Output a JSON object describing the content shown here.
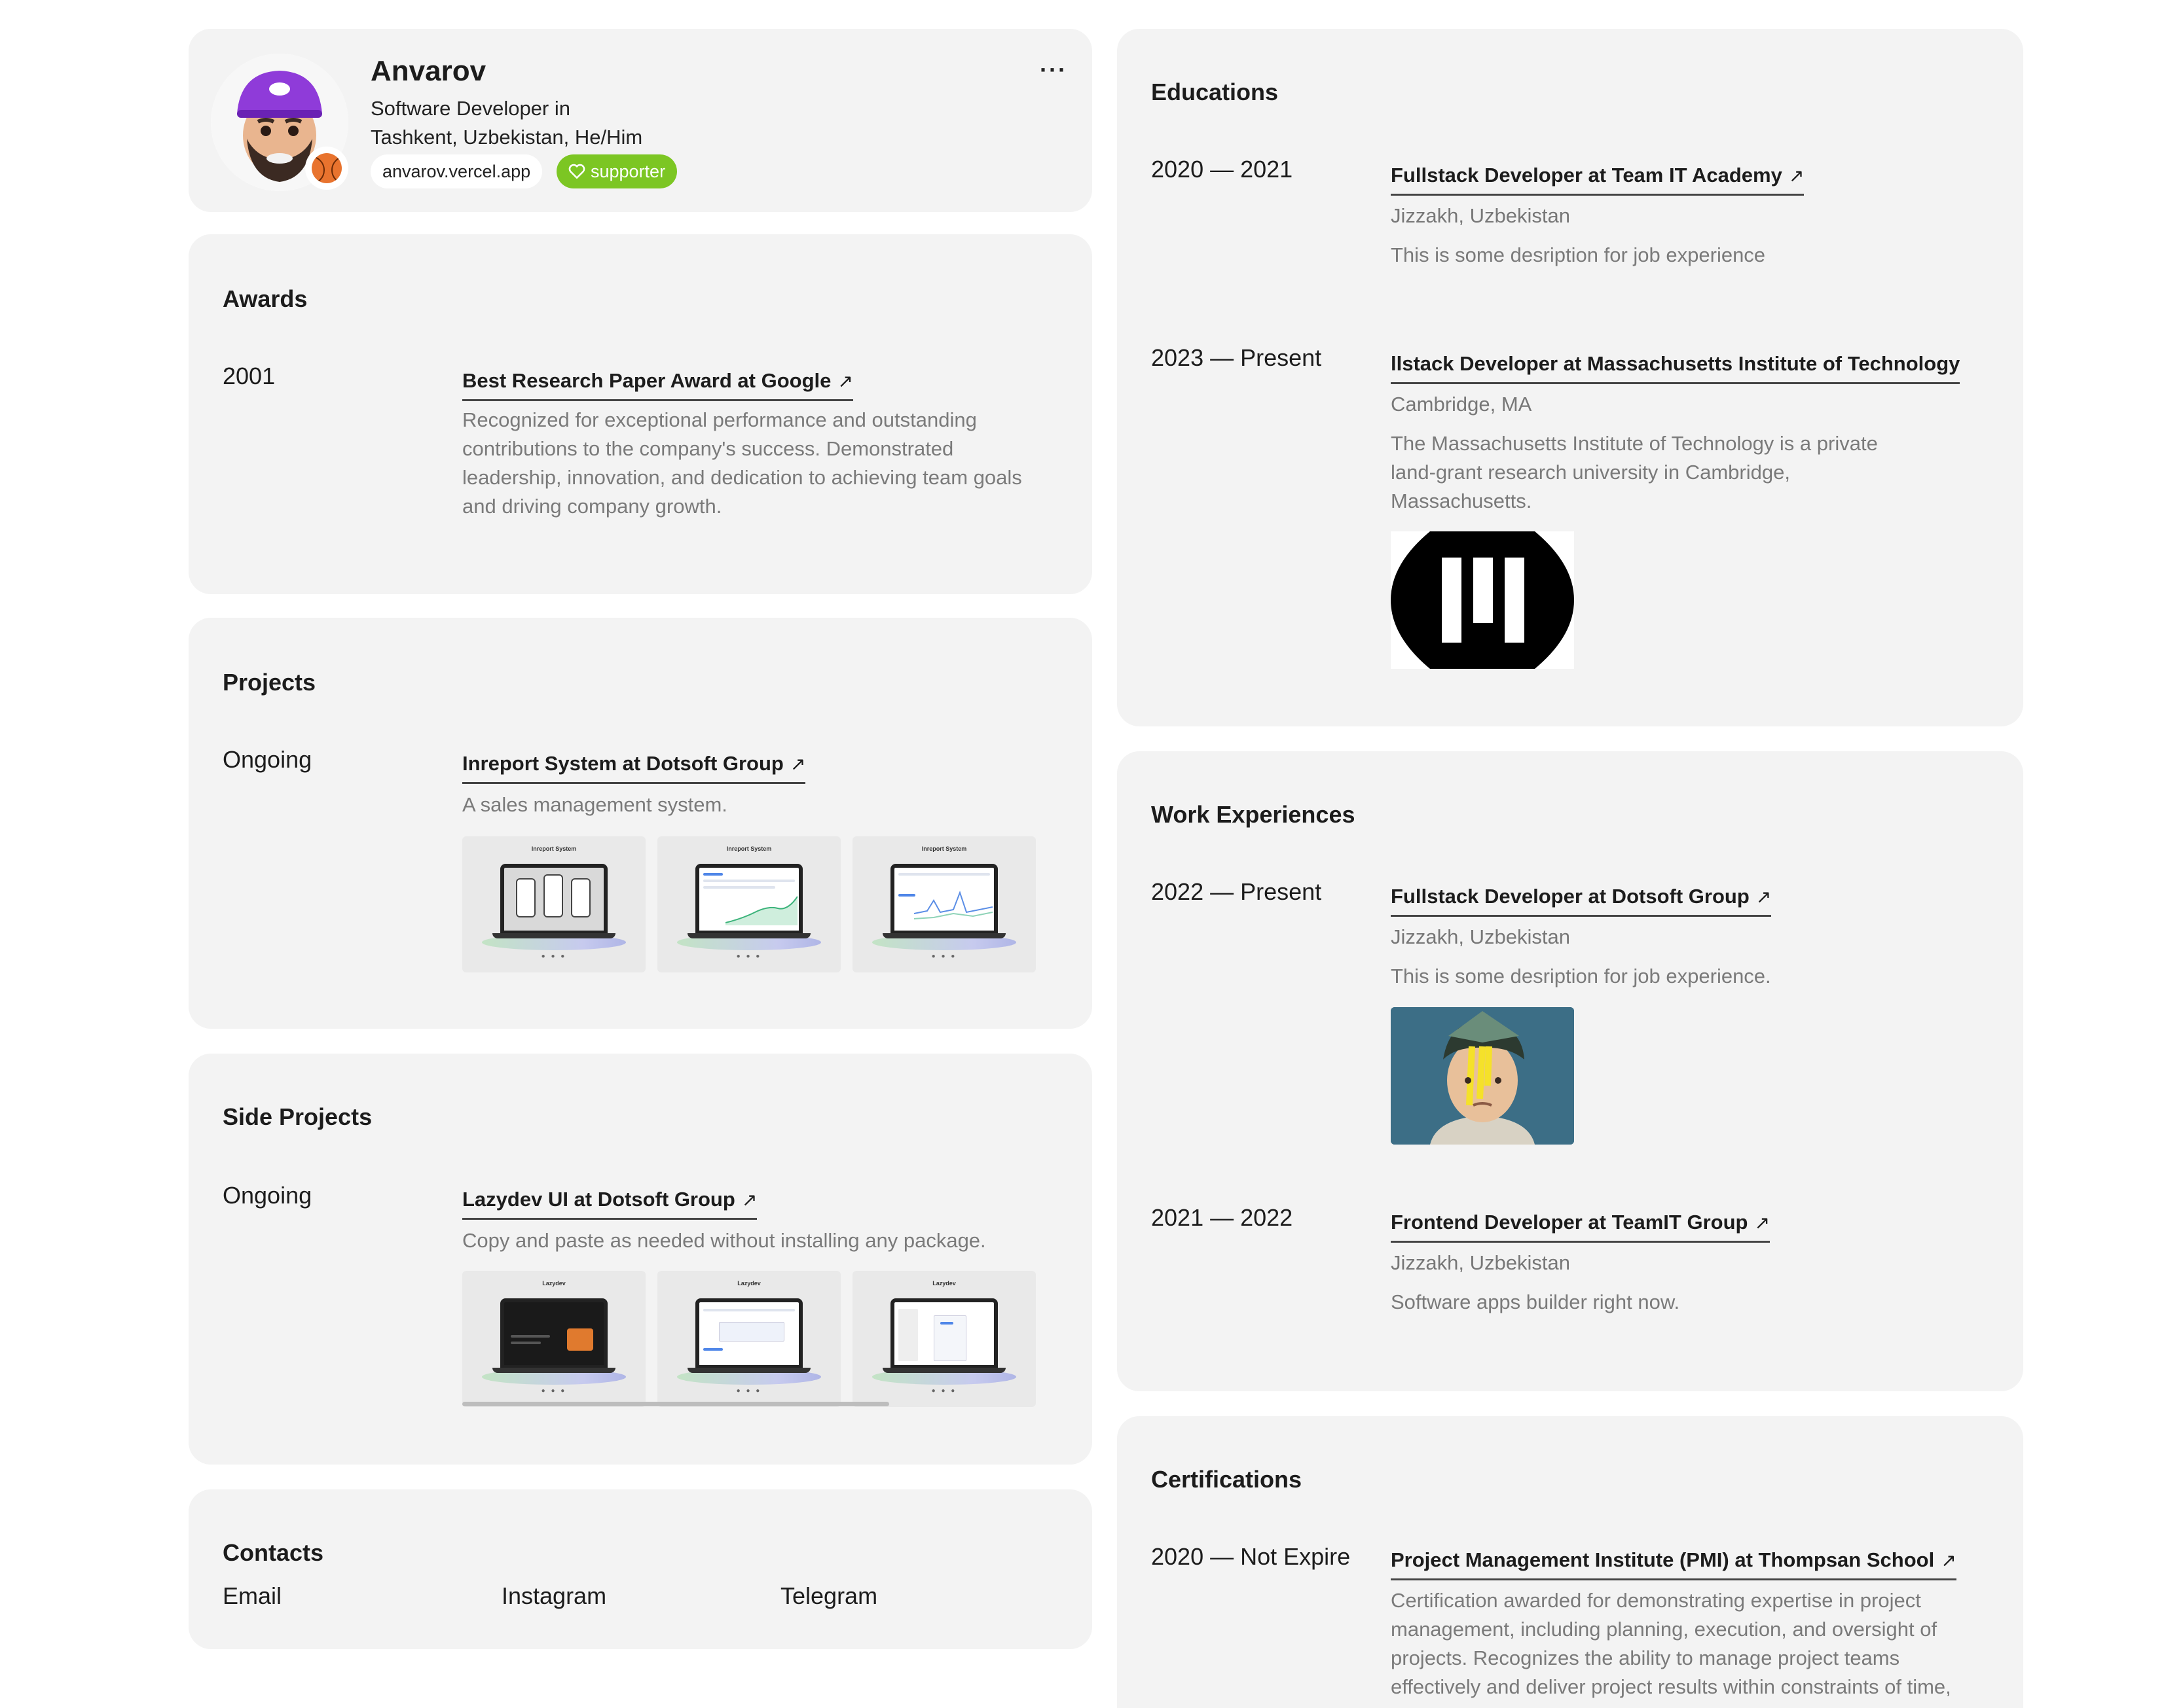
{
  "profile": {
    "name": "Anvarov",
    "subtitle_line1": "Software Developer in",
    "subtitle_line2": "Tashkent, Uzbekistan, He/Him",
    "site_pill": "anvarov.vercel.app",
    "supporter_pill": "supporter",
    "more_icon": "more-horizontal-icon",
    "more_label": "···"
  },
  "awards": {
    "title": "Awards",
    "items": [
      {
        "period": "2001",
        "title": "Best Research Paper Award at Google",
        "description": "Recognized for exceptional performance and outstanding contributions to the company's success. Demonstrated leadership, innovation, and dedication to achieving team goals and driving company growth."
      }
    ]
  },
  "projects": {
    "title": "Projects",
    "items": [
      {
        "period": "Ongoing",
        "title": "Inreport System at Dotsoft Group",
        "description": "A sales management system.",
        "thumb_title": "Inreport System"
      }
    ]
  },
  "side_projects": {
    "title": "Side Projects",
    "items": [
      {
        "period": "Ongoing",
        "title": "Lazydev UI at Dotsoft Group",
        "description": "Copy and paste as needed without installing any package.",
        "thumb_title": "Lazydev"
      }
    ]
  },
  "contacts": {
    "title": "Contacts",
    "links": [
      "Email",
      "Instagram",
      "Telegram"
    ]
  },
  "educations": {
    "title": "Educations",
    "items": [
      {
        "period": "2020 — 2021",
        "title": "Fullstack Developer at Team IT Academy",
        "location": "Jizzakh, Uzbekistan",
        "description": "This is some desription for job experience"
      },
      {
        "period": "2023 — Present",
        "title": "llstack Developer at Massachusetts Institute of Technology",
        "location": "Cambridge, MA",
        "description": "The Massachusetts Institute of Technology is a private land-grant research university in Cambridge, Massachusetts."
      }
    ]
  },
  "work": {
    "title": "Work Experiences",
    "items": [
      {
        "period": "2022 — Present",
        "title": "Fullstack Developer at Dotsoft Group",
        "location": "Jizzakh, Uzbekistan",
        "description": "This is some desription for job experience."
      },
      {
        "period": "2021 — 2022",
        "title": "Frontend Developer at TeamIT Group",
        "location": "Jizzakh, Uzbekistan",
        "description": "Software apps builder right now."
      }
    ]
  },
  "certifications": {
    "title": "Certifications",
    "items": [
      {
        "period": "2020 — Not Expire",
        "title": "Project Management Institute (PMI) at Thompsan School",
        "description": "Certification awarded for demonstrating expertise in project management, including planning, execution, and oversight of projects. Recognizes the ability to manage project teams effectively and deliver project results within constraints of time, cost, and resources."
      }
    ]
  },
  "link_arrow": "↗",
  "colors": {
    "card_bg": "#f3f3f3",
    "supporter_green": "#7cc623",
    "muted_text": "#7a7a7a"
  }
}
